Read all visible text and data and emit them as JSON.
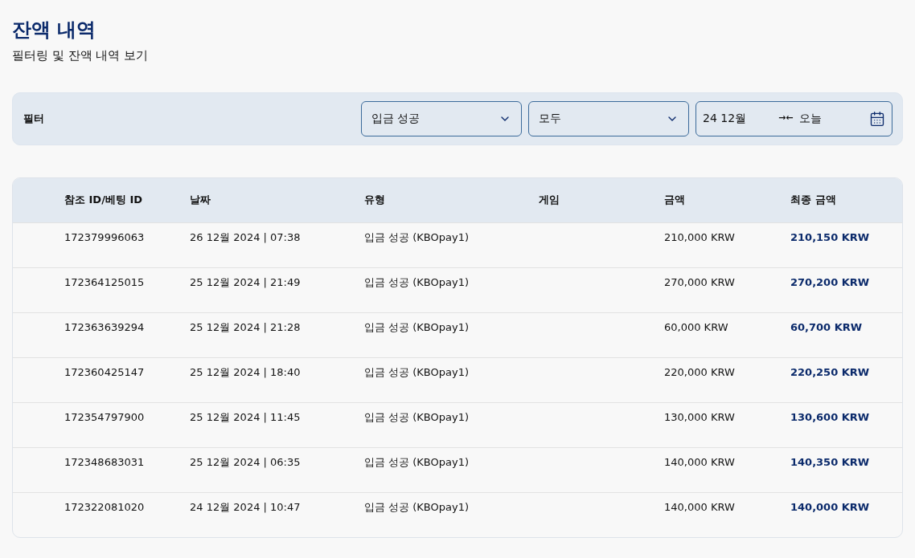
{
  "page": {
    "title": "잔액 내역",
    "subtitle": "필터링 및 잔액 내역 보기"
  },
  "filter": {
    "label": "필터",
    "type_select": "입금 성공",
    "status_select": "모두",
    "date_range": {
      "from": "24 12월",
      "separator": "→←",
      "to": "오늘"
    }
  },
  "table": {
    "columns": [
      "참조 ID/베팅 ID",
      "날짜",
      "유형",
      "게임",
      "금액",
      "최종 금액"
    ],
    "rows": [
      [
        "172379996063",
        "26 12월 2024 | 07:38",
        "입금 성공 (KBOpay1)",
        "",
        "210,000 KRW",
        "210,150 KRW"
      ],
      [
        "172364125015",
        "25 12월 2024 | 21:49",
        "입금 성공 (KBOpay1)",
        "",
        "270,000 KRW",
        "270,200 KRW"
      ],
      [
        "172363639294",
        "25 12월 2024 | 21:28",
        "입금 성공 (KBOpay1)",
        "",
        "60,000 KRW",
        "60,700 KRW"
      ],
      [
        "172360425147",
        "25 12월 2024 | 18:40",
        "입금 성공 (KBOpay1)",
        "",
        "220,000 KRW",
        "220,250 KRW"
      ],
      [
        "172354797900",
        "25 12월 2024 | 11:45",
        "입금 성공 (KBOpay1)",
        "",
        "130,000 KRW",
        "130,600 KRW"
      ],
      [
        "172348683031",
        "25 12월 2024 | 06:35",
        "입금 성공 (KBOpay1)",
        "",
        "140,000 KRW",
        "140,350 KRW"
      ],
      [
        "172322081020",
        "24 12월 2024 | 10:47",
        "입금 성공 (KBOpay1)",
        "",
        "140,000 KRW",
        "140,000 KRW"
      ]
    ]
  }
}
